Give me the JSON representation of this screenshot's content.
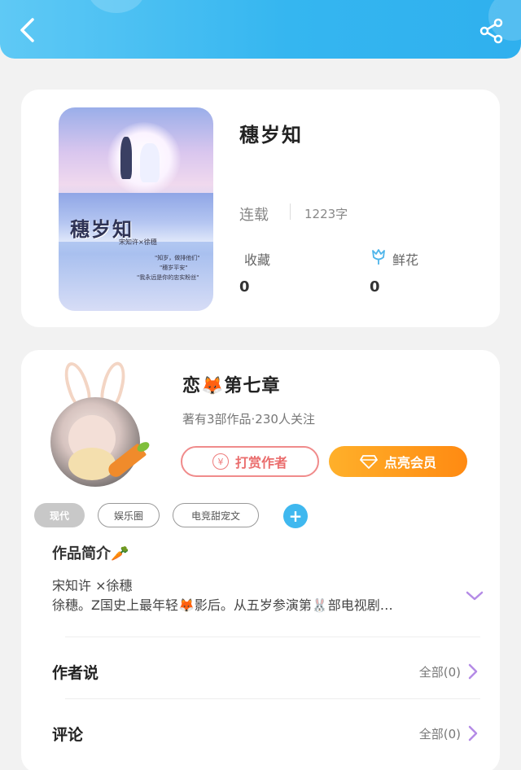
{
  "header": {
    "back_icon": "chevron-left-icon",
    "share_icon": "share-icon",
    "colors": {
      "start": "#5fc9f5",
      "end": "#2fb0ee"
    }
  },
  "book": {
    "cover": {
      "title": "穗岁知",
      "subtitle": "宋知许×徐穗",
      "quotes": [
        "\"知岁，做排他们\"",
        "\"穗岁平安\"",
        "\"我永远是你的忠实粉丝\""
      ]
    },
    "title": "穗岁知",
    "status": "连载",
    "word_count": "1223字",
    "favorites_label": "收藏",
    "favorites_value": "0",
    "flowers_label": "鲜花",
    "flowers_value": "0",
    "flower_icon": "tulip-icon"
  },
  "author": {
    "name": "恋🦊第七章",
    "meta": "著有3部作品·230人关注",
    "reward_label": "打赏作者",
    "vip_label": "点亮会员",
    "colors": {
      "reward": "#ea6c6c",
      "vip_start": "#ffb02a",
      "vip_end": "#ff8a12"
    }
  },
  "tags": {
    "items": [
      "现代",
      "娱乐圈",
      "电竞甜宠文"
    ],
    "add_label": "+"
  },
  "intro": {
    "title": "作品简介🥕",
    "line1": "宋知许 ×徐穗",
    "line2": "徐穗。Z国史上最年轻🦊影后。从五岁参演第🐰部电视剧…"
  },
  "author_says": {
    "title": "作者说",
    "link": "全部(0)"
  },
  "comments": {
    "title": "评论",
    "link": "全部(0)"
  }
}
